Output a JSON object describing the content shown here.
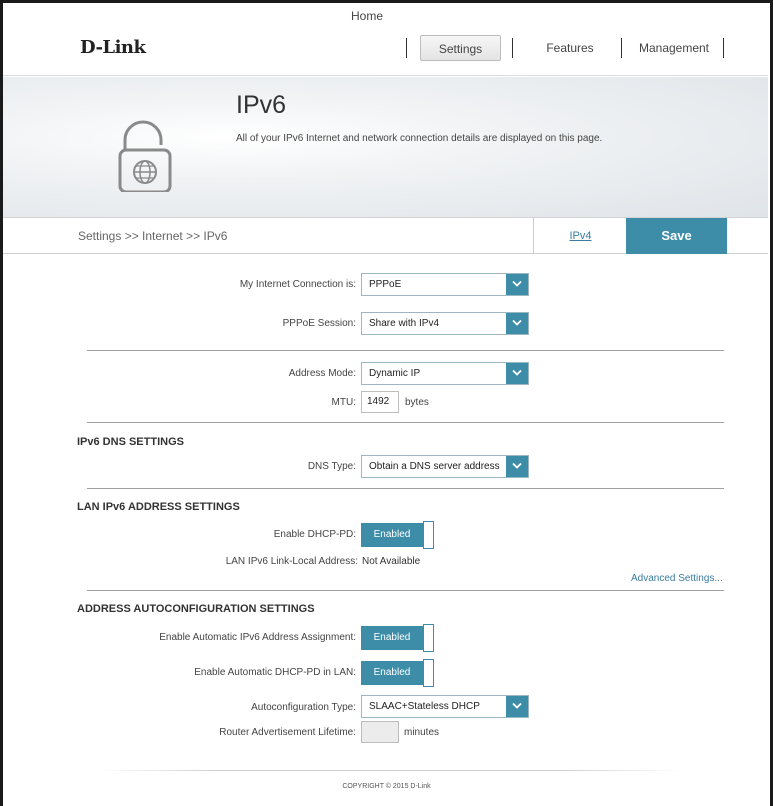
{
  "brand": "D-Link",
  "nav": {
    "home": "Home",
    "settings": "Settings",
    "features": "Features",
    "management": "Management"
  },
  "banner": {
    "title": "IPv6",
    "description": "All of your IPv6 Internet and network connection details are displayed on this page.",
    "icon": "lock-globe-icon"
  },
  "breadcrumb": "Settings >> Internet >> IPv6",
  "actions": {
    "ipv4_link": "IPv4",
    "save": "Save"
  },
  "connection": {
    "label": "My Internet Connection is:",
    "value": "PPPoE",
    "session_label": "PPPoE Session:",
    "session_value": "Share with IPv4"
  },
  "address": {
    "mode_label": "Address Mode:",
    "mode_value": "Dynamic IP",
    "mtu_label": "MTU:",
    "mtu_value": "1492",
    "mtu_unit": "bytes"
  },
  "dns": {
    "heading": "IPv6 DNS SETTINGS",
    "type_label": "DNS Type:",
    "type_value": "Obtain a DNS server address"
  },
  "lan": {
    "heading": "LAN IPv6 ADDRESS SETTINGS",
    "dhcp_pd_label": "Enable DHCP-PD:",
    "dhcp_pd_value": "Enabled",
    "link_local_label": "LAN IPv6 Link-Local Address:",
    "link_local_value": "Not Available",
    "advanced_link": "Advanced Settings..."
  },
  "autoconf": {
    "heading": "ADDRESS AUTOCONFIGURATION SETTINGS",
    "auto_assign_label": "Enable Automatic IPv6 Address Assignment:",
    "auto_assign_value": "Enabled",
    "auto_dhcp_pd_label": "Enable Automatic DHCP-PD in LAN:",
    "auto_dhcp_pd_value": "Enabled",
    "type_label": "Autoconfiguration Type:",
    "type_value": "SLAAC+Stateless DHCP",
    "ra_lifetime_label": "Router Advertisement Lifetime:",
    "ra_lifetime_value": "",
    "ra_lifetime_unit": "minutes"
  },
  "footer": "COPYRIGHT © 2015 D-Link",
  "colors": {
    "accent": "#3d8ca8",
    "link": "#3a7da0"
  }
}
